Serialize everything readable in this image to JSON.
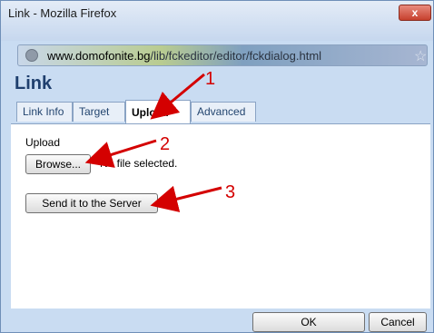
{
  "window": {
    "title": "Link - Mozilla Firefox",
    "close_label": "x"
  },
  "urlbar": {
    "domain": "www.domofonite.bg",
    "path": "/lib/fckeditor/editor/fckdialog.html"
  },
  "dialog": {
    "title": "Link",
    "tabs": [
      {
        "label": "Link Info",
        "active": false
      },
      {
        "label": "Target",
        "active": false
      },
      {
        "label": "Upload",
        "active": true
      },
      {
        "label": "Advanced",
        "active": false
      }
    ],
    "upload_label": "Upload",
    "browse_label": "Browse...",
    "file_status": "No file selected.",
    "send_label": "Send it to the Server",
    "ok_label": "OK",
    "cancel_label": "Cancel"
  },
  "annotations": {
    "arrow1": "1",
    "arrow2": "2",
    "arrow3": "3",
    "color": "#d40000"
  }
}
